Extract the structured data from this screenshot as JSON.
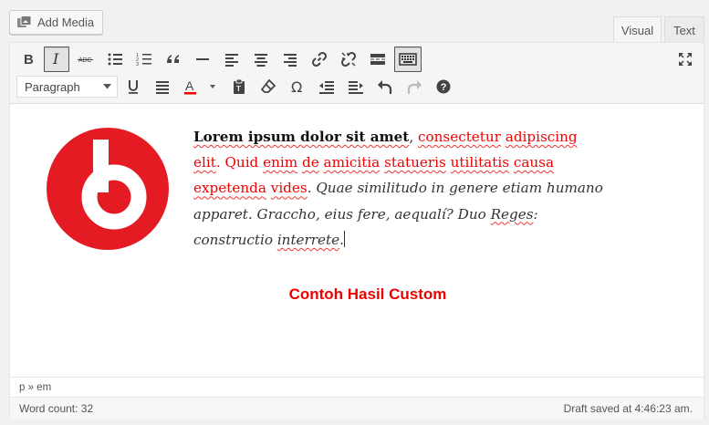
{
  "media": {
    "add_media_label": "Add Media"
  },
  "tabs": {
    "visual": "Visual",
    "text": "Text"
  },
  "toolbar": {
    "format_select_value": "Paragraph",
    "row1_buttons": [
      "bold-button",
      "italic-button",
      "strikethrough-button",
      "bullet-list-button",
      "numbered-list-button",
      "blockquote-button",
      "horizontal-line-button",
      "align-left-button",
      "align-center-button",
      "align-right-button",
      "insert-link-button",
      "remove-link-button",
      "read-more-button",
      "toolbar-toggle-button",
      "fullscreen-button"
    ],
    "row2_buttons": [
      "format-select",
      "underline-button",
      "justify-button",
      "text-color-button",
      "paste-as-text-button",
      "clear-formatting-button",
      "special-character-button",
      "decrease-indent-button",
      "increase-indent-button",
      "undo-button",
      "redo-button",
      "help-button"
    ]
  },
  "content": {
    "bold_text": "Lorem ipsum dolor sit amet",
    "comma": ", ",
    "red_text_1": "consectetur",
    "red_text_2": "adipiscing",
    "red_text_3": "elit",
    "red_text_4": ". Quid",
    "red_text_5": "enim",
    "red_text_6": "de",
    "red_text_7": "amicitia",
    "red_text_8": "statueris",
    "red_text_9": "utilitatis",
    "red_text_10": "causa",
    "red_text_11": "expetenda",
    "red_text_12": "vides",
    "italic_1": ". Quae similitudo in genere etiam humano apparet. Graccho, eius fere, aequalí? Duo ",
    "italic_reges": "Reges",
    "italic_2": ": constructio ",
    "italic_interrete": "interrete",
    "italic_end": ".",
    "custom_title": "Contoh Hasil Custom",
    "accent_red": "#e00000",
    "logo_red": "#e51b24"
  },
  "path": "p » em",
  "status": {
    "word_count": "Word count: 32",
    "draft_saved": "Draft saved at 4:46:23 am."
  }
}
